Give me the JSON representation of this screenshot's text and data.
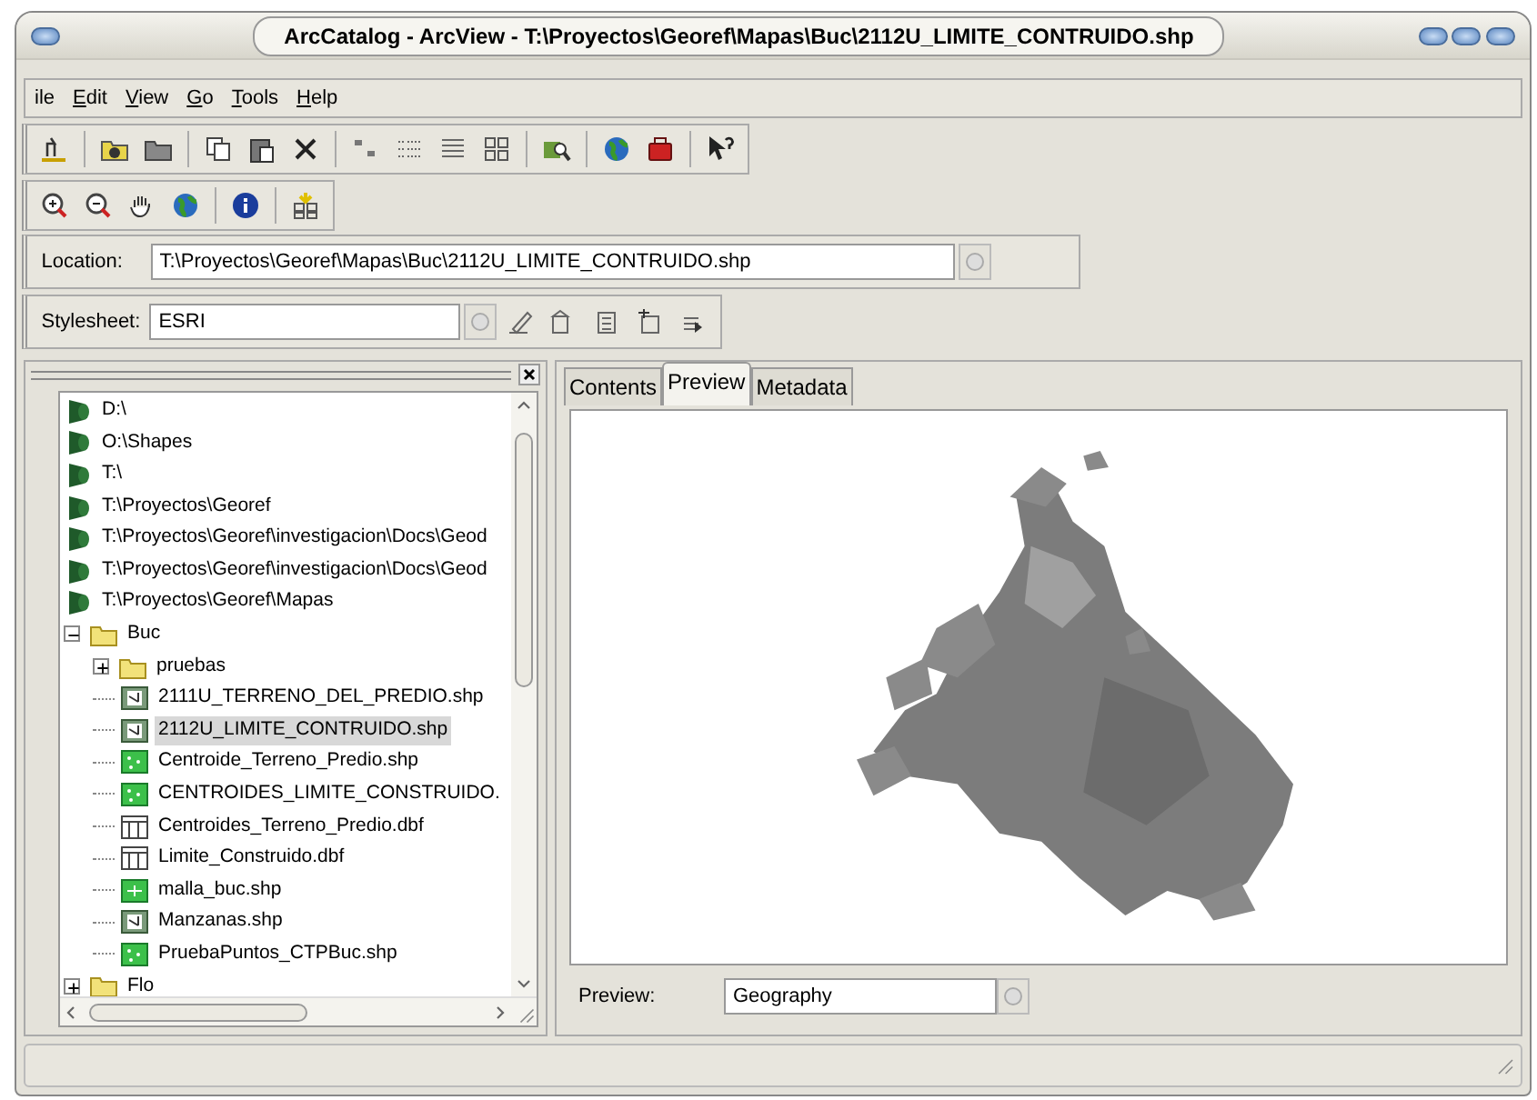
{
  "window": {
    "title": "ArcCatalog - ArcView - T:\\Proyectos\\Georef\\Mapas\\Buc\\2112U_LIMITE_CONTRUIDO.shp"
  },
  "menu": [
    {
      "label": "ile",
      "mnemonic_first": false
    },
    {
      "label": "Edit",
      "mnemonic_first": true
    },
    {
      "label": "View",
      "mnemonic_first": true
    },
    {
      "label": "Go",
      "mnemonic_first": true
    },
    {
      "label": "Tools",
      "mnemonic_first": true
    },
    {
      "label": "Help",
      "mnemonic_first": true
    }
  ],
  "location": {
    "label": "Location:",
    "value": "T:\\Proyectos\\Georef\\Mapas\\Buc\\2112U_LIMITE_CONTRUIDO.shp"
  },
  "stylesheet": {
    "label": "Stylesheet:",
    "value": "ESRI"
  },
  "tree": [
    {
      "label": "D:\\",
      "kind": "connection",
      "selected": false
    },
    {
      "label": "O:\\Shapes",
      "kind": "connection",
      "selected": false
    },
    {
      "label": "T:\\",
      "kind": "connection",
      "selected": false
    },
    {
      "label": "T:\\Proyectos\\Georef",
      "kind": "connection",
      "selected": false
    },
    {
      "label": "T:\\Proyectos\\Georef\\investigacion\\Docs\\Geod",
      "kind": "connection",
      "selected": false
    },
    {
      "label": "T:\\Proyectos\\Georef\\investigacion\\Docs\\Geod",
      "kind": "connection",
      "selected": false
    },
    {
      "label": "T:\\Proyectos\\Georef\\Mapas",
      "kind": "connection",
      "selected": false,
      "children": [
        {
          "label": "Buc",
          "kind": "folder",
          "selected": false,
          "expanded": true,
          "children": [
            {
              "label": "pruebas",
              "kind": "folder",
              "selected": false,
              "expanded": false
            },
            {
              "label": "2111U_TERRENO_DEL_PREDIO.shp",
              "kind": "line",
              "selected": false
            },
            {
              "label": "2112U_LIMITE_CONTRUIDO.shp",
              "kind": "line",
              "selected": true
            },
            {
              "label": "Centroide_Terreno_Predio.shp",
              "kind": "point",
              "selected": false
            },
            {
              "label": "CENTROIDES_LIMITE_CONSTRUIDO.",
              "kind": "point",
              "selected": false
            },
            {
              "label": "Centroides_Terreno_Predio.dbf",
              "kind": "table",
              "selected": false
            },
            {
              "label": "Limite_Construido.dbf",
              "kind": "table",
              "selected": false
            },
            {
              "label": "malla_buc.shp",
              "kind": "grid",
              "selected": false
            },
            {
              "label": "Manzanas.shp",
              "kind": "line",
              "selected": false
            },
            {
              "label": "PruebaPuntos_CTPBuc.shp",
              "kind": "point",
              "selected": false
            }
          ]
        },
        {
          "label": "Flo",
          "kind": "folder",
          "selected": false,
          "expanded": false
        }
      ]
    }
  ],
  "tabs": [
    {
      "label": "Contents",
      "selected": false
    },
    {
      "label": "Preview",
      "selected": true
    },
    {
      "label": "Metadata",
      "selected": false
    }
  ],
  "preview_bar": {
    "label": "Preview:",
    "value": "Geography"
  }
}
